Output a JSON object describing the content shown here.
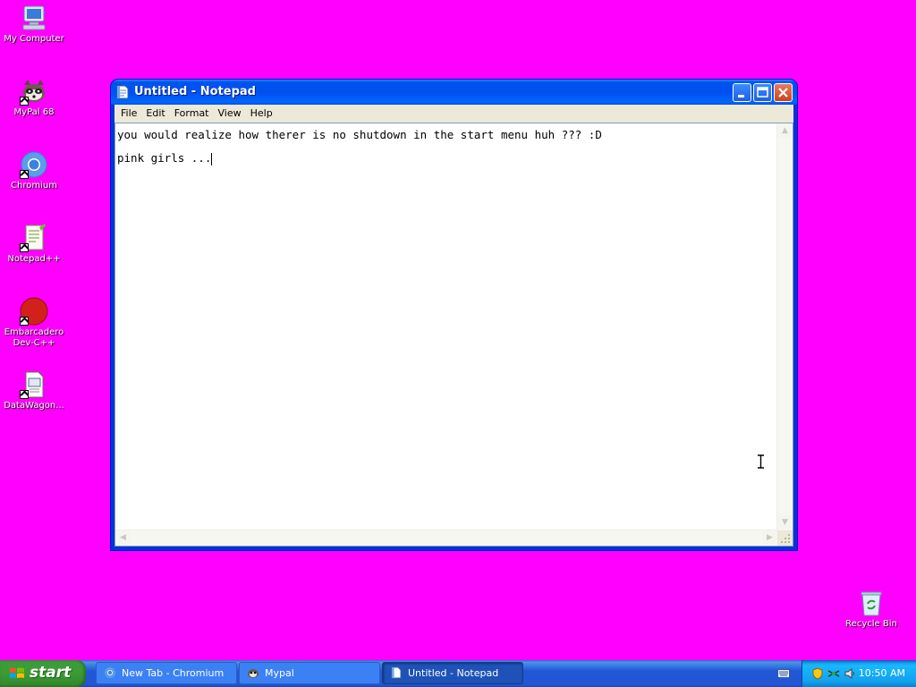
{
  "desktop": {
    "icons": [
      {
        "label": "My Computer"
      },
      {
        "label": "MyPal 68"
      },
      {
        "label": "Chromium"
      },
      {
        "label": "Notepad++"
      },
      {
        "label": "Embarcadero Dev-C++"
      },
      {
        "label": "DataWagon..."
      },
      {
        "label": "Recycle Bin"
      }
    ]
  },
  "window": {
    "title": "Untitled - Notepad",
    "menu": [
      "File",
      "Edit",
      "Format",
      "View",
      "Help"
    ],
    "text_lines": [
      "you would realize how therer is no shutdown in the start menu huh ??? :D",
      "pink girls ..."
    ]
  },
  "taskbar": {
    "start_label": "start",
    "tasks": [
      {
        "label": "New Tab - Chromium",
        "icon": "chromium-icon",
        "active": false
      },
      {
        "label": "Mypal",
        "icon": "mypal-icon",
        "active": false
      },
      {
        "label": "Untitled - Notepad",
        "icon": "notepad-icon",
        "active": true
      }
    ],
    "clock": "10:50 AM"
  },
  "colors": {
    "desktop_background": "#ff00ff",
    "titlebar": "#0054e3",
    "taskbar": "#245edb",
    "start_button": "#3c9d3c"
  }
}
